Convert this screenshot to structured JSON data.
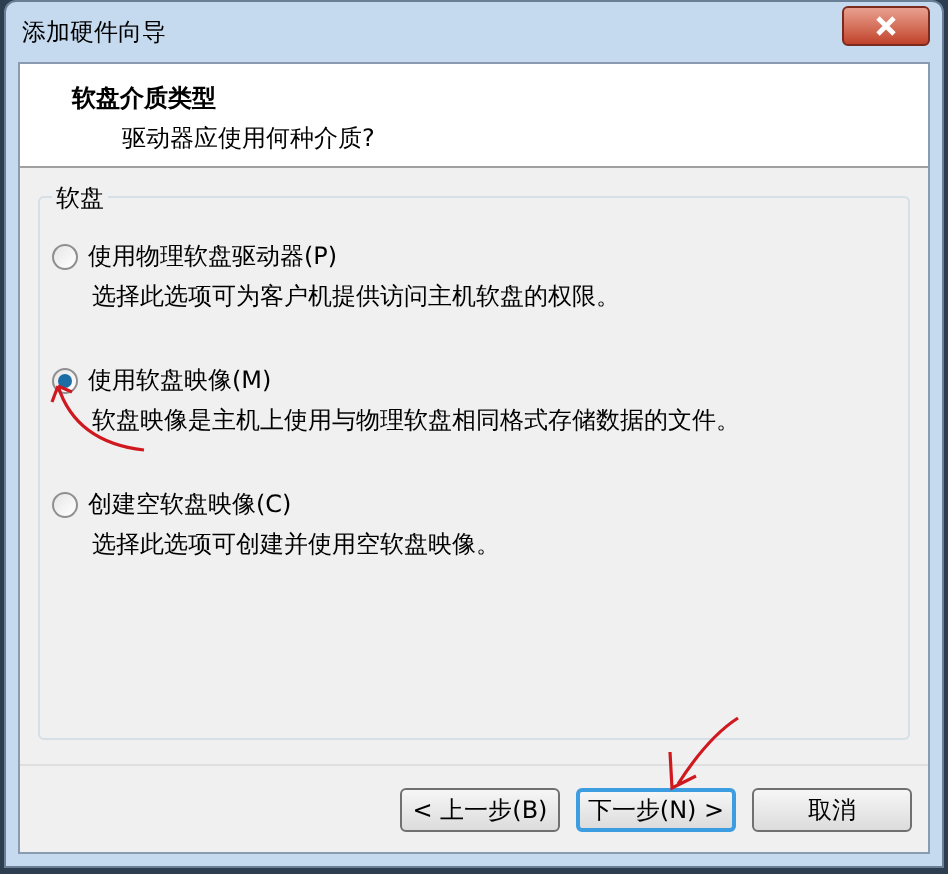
{
  "window": {
    "title": "添加硬件向导"
  },
  "header": {
    "title": "软盘介质类型",
    "subtitle": "驱动器应使用何种介质?"
  },
  "group": {
    "label": "软盘",
    "options": [
      {
        "label": "使用物理软盘驱动器(P)",
        "description": "选择此选项可为客户机提供访问主机软盘的权限。",
        "selected": false
      },
      {
        "label": "使用软盘映像(M)",
        "description": "软盘映像是主机上使用与物理软盘相同格式存储数据的文件。",
        "selected": true
      },
      {
        "label": "创建空软盘映像(C)",
        "description": "选择此选项可创建并使用空软盘映像。",
        "selected": false
      }
    ]
  },
  "buttons": [
    {
      "label": "< 上一步(B)",
      "focused": false
    },
    {
      "label": "下一步(N) >",
      "focused": true
    },
    {
      "label": "取消",
      "focused": false
    }
  ]
}
